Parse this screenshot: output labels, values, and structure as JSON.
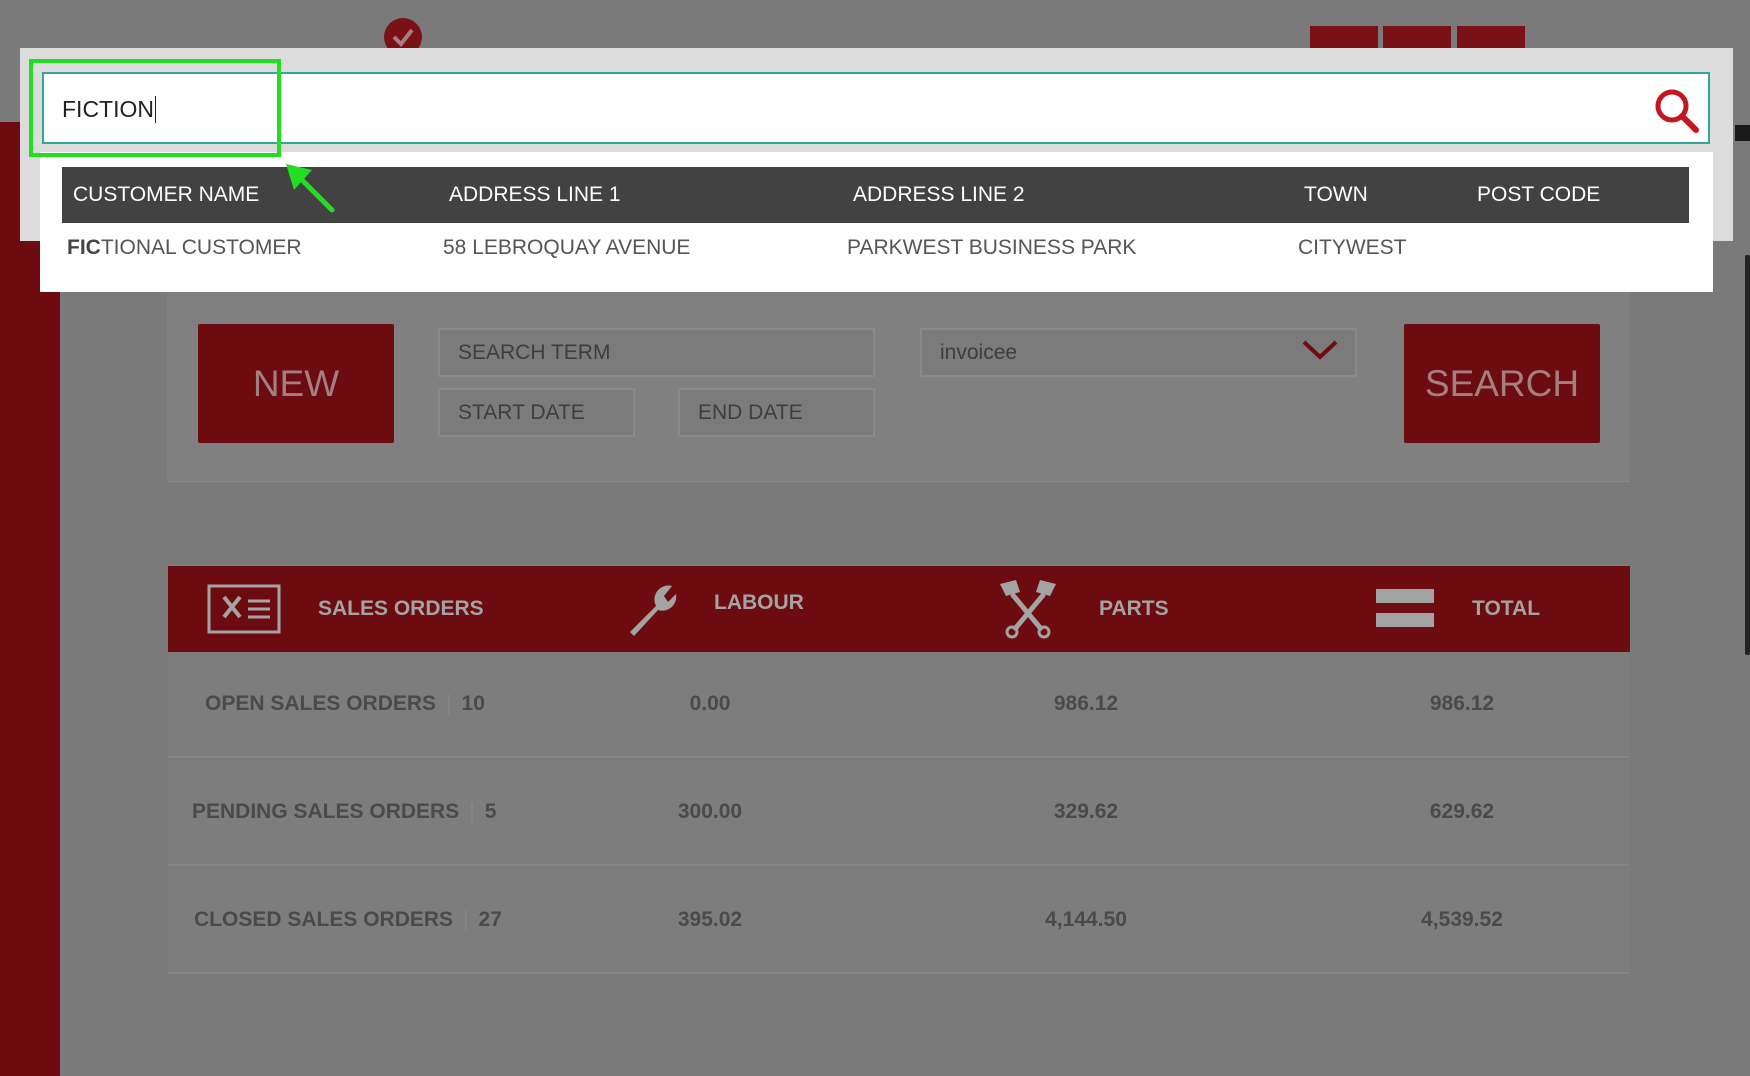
{
  "search": {
    "value": "FICTION"
  },
  "results": {
    "headers": [
      "CUSTOMER NAME",
      "ADDRESS LINE 1",
      "ADDRESS LINE 2",
      "TOWN",
      "POST CODE"
    ],
    "rows": [
      {
        "name_match": "FIC",
        "name_rest": "TIONAL CUSTOMER",
        "address1": "58 LEBROQUAY AVENUE",
        "address2": "PARKWEST BUSINESS PARK",
        "town": "CITYWEST",
        "postcode": ""
      }
    ]
  },
  "panel": {
    "new_label": "NEW",
    "search_term_placeholder": "SEARCH TERM",
    "start_date_placeholder": "START DATE",
    "end_date_placeholder": "END DATE",
    "type_selected": "invoicee",
    "search_label": "SEARCH"
  },
  "summary": {
    "headers": {
      "orders": "SALES ORDERS",
      "labour": "LABOUR",
      "parts": "PARTS",
      "total": "TOTAL"
    },
    "rows": [
      {
        "label": "OPEN SALES ORDERS",
        "count": "10",
        "labour": "0.00",
        "parts": "986.12",
        "total": "986.12"
      },
      {
        "label": "PENDING SALES ORDERS",
        "count": "5",
        "labour": "300.00",
        "parts": "329.62",
        "total": "629.62"
      },
      {
        "label": "CLOSED SALES ORDERS",
        "count": "27",
        "labour": "395.02",
        "parts": "4,144.50",
        "total": "4,539.52"
      }
    ]
  },
  "colors": {
    "brand_red": "#c2171e",
    "accent_teal": "#2fa899",
    "annotation_green": "#22dd22"
  },
  "icons": [
    "check-icon",
    "search-icon",
    "sales-orders-icon",
    "wrench-icon",
    "pistons-icon",
    "equals-icon",
    "chevron-down-icon"
  ]
}
